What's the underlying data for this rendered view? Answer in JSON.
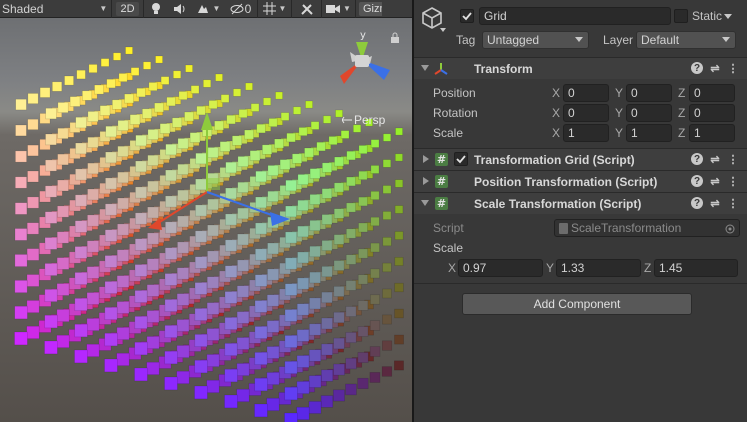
{
  "scene": {
    "shading_mode": "Shaded",
    "mode_2d": "2D",
    "hidden_count": "0",
    "gizmos_label": "Gizmos",
    "persp_label": "Persp",
    "gizmo_axis_y": "y"
  },
  "gameobject": {
    "name": "Grid",
    "active": true,
    "static_label": "Static",
    "tag_label": "Tag",
    "tag_value": "Untagged",
    "layer_label": "Layer",
    "layer_value": "Default"
  },
  "transform": {
    "title": "Transform",
    "position_label": "Position",
    "rotation_label": "Rotation",
    "scale_label": "Scale",
    "position": {
      "x": "0",
      "y": "0",
      "z": "0"
    },
    "rotation": {
      "x": "0",
      "y": "0",
      "z": "0"
    },
    "scale": {
      "x": "1",
      "y": "1",
      "z": "1"
    },
    "axis_x": "X",
    "axis_y": "Y",
    "axis_z": "Z"
  },
  "components": {
    "transformation_grid": "Transformation Grid (Script)",
    "transformation_grid_enabled": true,
    "position_transformation": "Position Transformation (Script)",
    "scale_transformation": "Scale Transformation (Script)"
  },
  "scale_transformation": {
    "script_label": "Script",
    "script_value": "ScaleTransformation",
    "scale_label": "Scale",
    "x": "0.97",
    "y": "1.33",
    "z": "1.45"
  },
  "add_component_label": "Add Component",
  "colors": {
    "inspector_bg": "#383838",
    "field_bg": "#2a2a2a",
    "gizmo_x": "#e0472c",
    "gizmo_y": "#8ecb3c",
    "gizmo_z": "#3b70e6",
    "script_icon": "#4b7d43"
  },
  "icons": {
    "gameobject": "cube-icon",
    "light": "lightbulb-icon",
    "audio": "speaker-icon",
    "effects": "effects-icon",
    "hidden": "eye-off-icon",
    "grid": "grid-icon",
    "tools": "tools-icon",
    "camera": "camera-icon",
    "lock": "lock-icon",
    "help": "help-icon",
    "presets": "sliders-icon",
    "menu": "kebab-menu-icon",
    "script": "script-icon",
    "target": "target-icon"
  }
}
